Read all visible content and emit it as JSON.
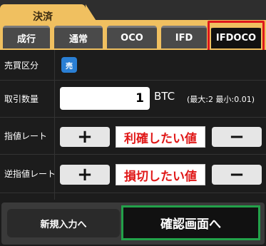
{
  "section_tab": {
    "label": "決済"
  },
  "order_tabs": [
    {
      "label": "成行",
      "active": false
    },
    {
      "label": "通常",
      "active": false
    },
    {
      "label": "OCO",
      "active": false
    },
    {
      "label": "IFD",
      "active": false
    },
    {
      "label": "IFDOCO",
      "active": true
    }
  ],
  "form": {
    "side": {
      "label": "売買区分",
      "value": "売"
    },
    "quantity": {
      "label": "取引数量",
      "value": "1",
      "unit": "BTC",
      "limit_text": "(最大:2 最小:0.01)"
    },
    "limit_rate": {
      "label": "指値レート",
      "plus": "+",
      "minus": "−",
      "value": "利確したい値"
    },
    "stop_rate": {
      "label": "逆指値レート",
      "plus": "+",
      "minus": "−",
      "value": "損切したい値"
    }
  },
  "actions": {
    "new_entry": "新規入力へ",
    "confirm": "確認画面へ"
  },
  "colors": {
    "accent": "#f0c060",
    "sell_badge": "#2a7fd4",
    "highlight_red": "#e0181c",
    "highlight_green": "#23a14a",
    "rate_text": "#e01818"
  }
}
